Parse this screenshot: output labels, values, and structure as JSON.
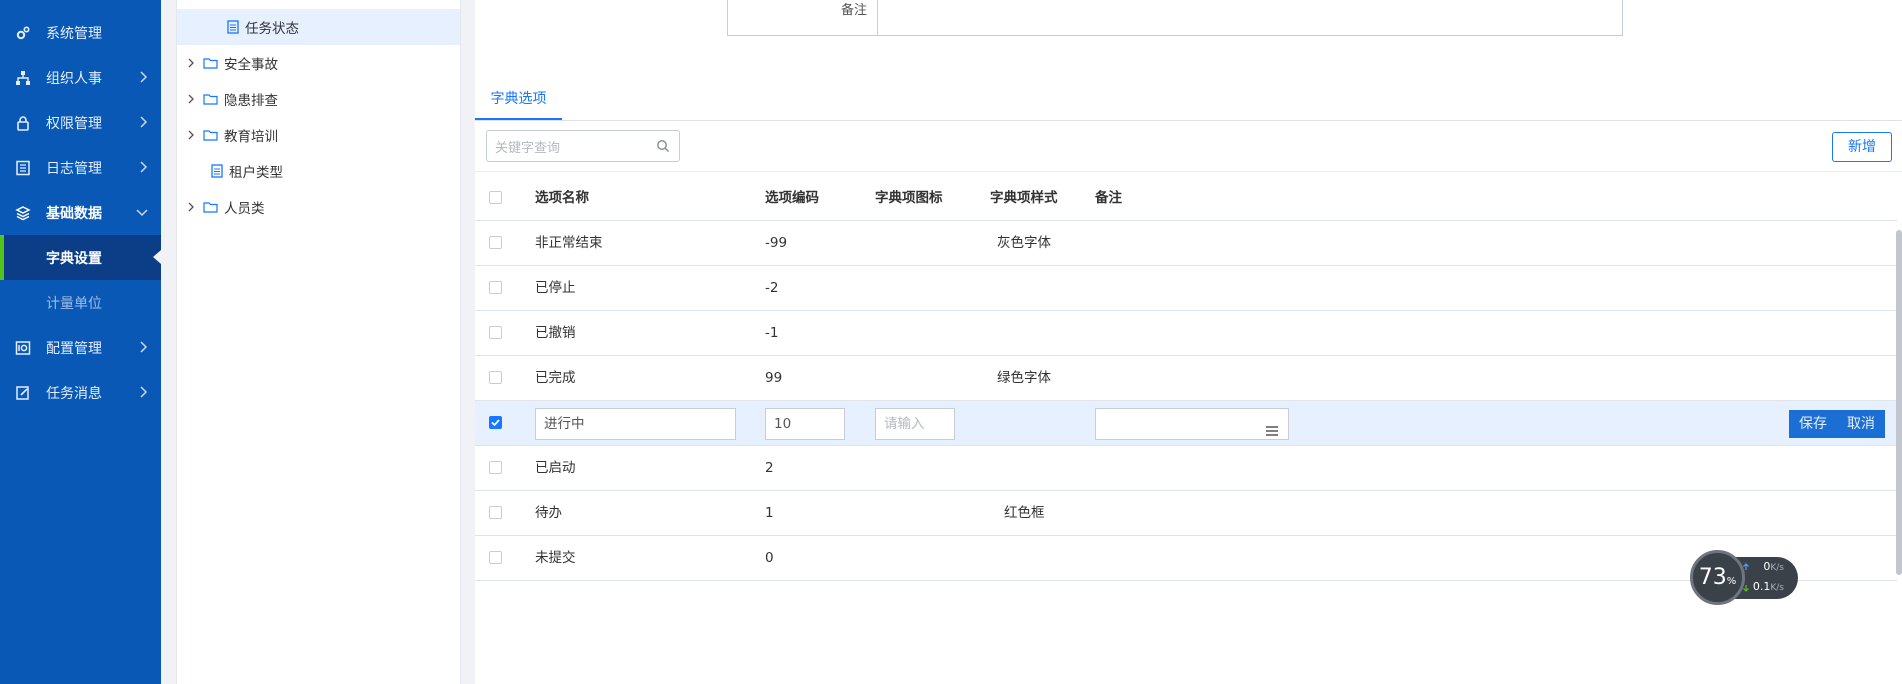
{
  "nav": {
    "items": [
      {
        "label": "系统管理"
      },
      {
        "label": "组织人事"
      },
      {
        "label": "权限管理"
      },
      {
        "label": "日志管理"
      },
      {
        "label": "基础数据"
      },
      {
        "label": "配置管理"
      },
      {
        "label": "任务消息"
      }
    ],
    "subitems": [
      {
        "label": "字典设置"
      },
      {
        "label": "计量单位"
      }
    ]
  },
  "tree": {
    "nodes": [
      {
        "label": "任务状态"
      },
      {
        "label": "安全事故"
      },
      {
        "label": "隐患排查"
      },
      {
        "label": "教育培训"
      },
      {
        "label": "租户类型"
      },
      {
        "label": "人员类"
      }
    ]
  },
  "form": {
    "remark_label": "备注"
  },
  "tab": {
    "label": "字典选项"
  },
  "toolbar": {
    "search_placeholder": "关键字查询",
    "add_label": "新增"
  },
  "table": {
    "columns": [
      "选项名称",
      "选项编码",
      "字典项图标",
      "字典项样式",
      "备注"
    ],
    "rows": [
      {
        "name": "非正常结束",
        "code": "-99",
        "icon": "",
        "style": "灰色字体",
        "remark": ""
      },
      {
        "name": "已停止",
        "code": "-2",
        "icon": "",
        "style": "",
        "remark": ""
      },
      {
        "name": "已撤销",
        "code": "-1",
        "icon": "",
        "style": "",
        "remark": ""
      },
      {
        "name": "已完成",
        "code": "99",
        "icon": "",
        "style": "绿色字体",
        "remark": ""
      },
      {
        "name": "已启动",
        "code": "2",
        "icon": "",
        "style": "",
        "remark": ""
      },
      {
        "name": "待办",
        "code": "1",
        "icon": "",
        "style": "红色框",
        "remark": ""
      },
      {
        "name": "未提交",
        "code": "0",
        "icon": "",
        "style": "",
        "remark": ""
      }
    ],
    "editing_row": {
      "name_value": "进行中",
      "code_value": "10",
      "icon_placeholder": "请输入",
      "save_label": "保存",
      "cancel_label": "取消"
    }
  },
  "network_widget": {
    "percent": "73",
    "percent_unit": "%",
    "upload": "0",
    "upload_unit": "K/s",
    "download": "0.1",
    "download_unit": "K/s"
  },
  "colors": {
    "nav_bg": "#0958b6",
    "nav_active_bg": "#0b3e86",
    "accent": "#1677ff",
    "active_indicator": "#52c41a"
  }
}
